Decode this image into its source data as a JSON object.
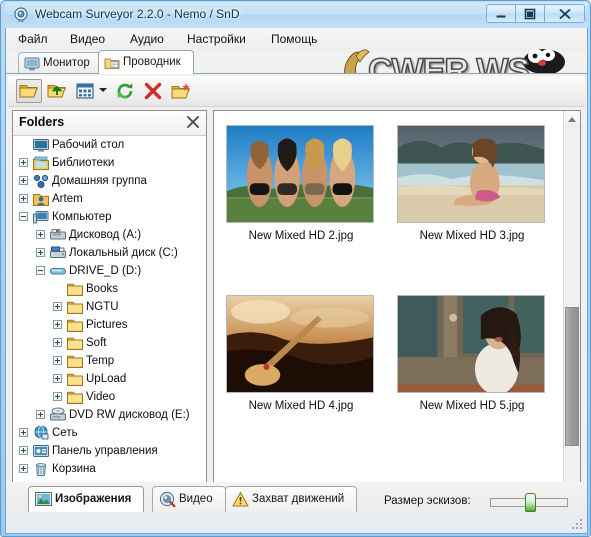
{
  "window": {
    "title": "Webcam Surveyor 2.2.0 - Nemo / SnD",
    "icon": "webcam-icon",
    "minimize_label": "Свернуть",
    "maximize_label": "Развернуть",
    "close_label": "Закрыть"
  },
  "watermark": {
    "text": "CWER.WS"
  },
  "menu": {
    "items": [
      {
        "label": "Файл"
      },
      {
        "label": "Видео"
      },
      {
        "label": "Аудио"
      },
      {
        "label": "Настройки"
      },
      {
        "label": "Помощь"
      }
    ]
  },
  "top_tabs": {
    "items": [
      {
        "label": "Монитор",
        "icon": "monitor-icon",
        "active": false
      },
      {
        "label": "Проводник",
        "icon": "folder-explorer-icon",
        "active": true
      }
    ]
  },
  "toolbar": {
    "buttons": [
      {
        "name": "open-folder-button",
        "icon": "open-folder-icon",
        "pressed": true
      },
      {
        "name": "up-folder-button",
        "icon": "folder-up-icon",
        "pressed": false
      },
      {
        "name": "view-mode-button",
        "icon": "thumbnails-view-icon",
        "pressed": false
      },
      {
        "name": "view-mode-dropdown",
        "icon": "chevron-down-icon",
        "pressed": false
      },
      {
        "name": "refresh-button",
        "icon": "refresh-icon",
        "pressed": false
      },
      {
        "name": "delete-button",
        "icon": "delete-x-icon",
        "pressed": false
      },
      {
        "name": "new-folder-button",
        "icon": "new-folder-icon",
        "pressed": false
      }
    ]
  },
  "folders_panel": {
    "title": "Folders",
    "close_icon": "close-icon",
    "tree": [
      {
        "label": "Рабочий стол",
        "depth": 0,
        "icon": "desktop-icon",
        "expander": "none"
      },
      {
        "label": "Библиотеки",
        "depth": 0,
        "icon": "libraries-icon",
        "expander": "plus"
      },
      {
        "label": "Домашняя группа",
        "depth": 0,
        "icon": "homegroup-icon",
        "expander": "plus"
      },
      {
        "label": "Artem",
        "depth": 0,
        "icon": "user-folder-icon",
        "expander": "plus"
      },
      {
        "label": "Компьютер",
        "depth": 0,
        "icon": "computer-icon",
        "expander": "minus"
      },
      {
        "label": "Дисковод (A:)",
        "depth": 1,
        "icon": "floppy-drive-icon",
        "expander": "plus"
      },
      {
        "label": "Локальный диск (C:)",
        "depth": 1,
        "icon": "hard-drive-icon",
        "expander": "plus"
      },
      {
        "label": "DRIVE_D (D:)",
        "depth": 1,
        "icon": "removable-drive-icon",
        "expander": "minus"
      },
      {
        "label": "Books",
        "depth": 2,
        "icon": "folder-icon",
        "expander": "none"
      },
      {
        "label": "NGTU",
        "depth": 2,
        "icon": "folder-icon",
        "expander": "plus"
      },
      {
        "label": "Pictures",
        "depth": 2,
        "icon": "folder-icon",
        "expander": "plus"
      },
      {
        "label": "Soft",
        "depth": 2,
        "icon": "folder-icon",
        "expander": "plus"
      },
      {
        "label": "Temp",
        "depth": 2,
        "icon": "folder-icon",
        "expander": "plus"
      },
      {
        "label": "UpLoad",
        "depth": 2,
        "icon": "folder-icon",
        "expander": "plus"
      },
      {
        "label": "Video",
        "depth": 2,
        "icon": "folder-icon",
        "expander": "plus"
      },
      {
        "label": "DVD RW дисковод (E:)",
        "depth": 1,
        "icon": "dvd-drive-icon",
        "expander": "plus"
      },
      {
        "label": "Сеть",
        "depth": 0,
        "icon": "network-icon",
        "expander": "plus"
      },
      {
        "label": "Панель управления",
        "depth": 0,
        "icon": "control-panel-icon",
        "expander": "plus"
      },
      {
        "label": "Корзина",
        "depth": 0,
        "icon": "recycle-bin-icon",
        "expander": "plus"
      }
    ]
  },
  "thumbnails": {
    "items": [
      {
        "filename": "New Mixed HD 2.jpg",
        "art": "beach-group"
      },
      {
        "filename": "New Mixed HD 3.jpg",
        "art": "beach-shore"
      },
      {
        "filename": "New Mixed HD 4.jpg",
        "art": "sunset-warm"
      },
      {
        "filename": "New Mixed HD 5.jpg",
        "art": "portrait-door"
      }
    ],
    "scrollbar": {
      "up_icon": "scroll-up-icon",
      "down_icon": "scroll-down-icon"
    }
  },
  "bottom_tabs": {
    "items": [
      {
        "label": "Изображения",
        "icon": "images-icon",
        "active": true
      },
      {
        "label": "Видео",
        "icon": "video-icon",
        "active": false
      },
      {
        "label": "Захват движений",
        "icon": "motion-alert-icon",
        "active": false
      }
    ]
  },
  "thumbnail_size": {
    "label": "Размер эскизов:",
    "value_percent": 45
  },
  "colors": {
    "frame_blue": "#9ccbee",
    "title_blue": "#c3e0f5",
    "slider_green": "#4fa832",
    "folder_yellow": "#f4c84a"
  }
}
